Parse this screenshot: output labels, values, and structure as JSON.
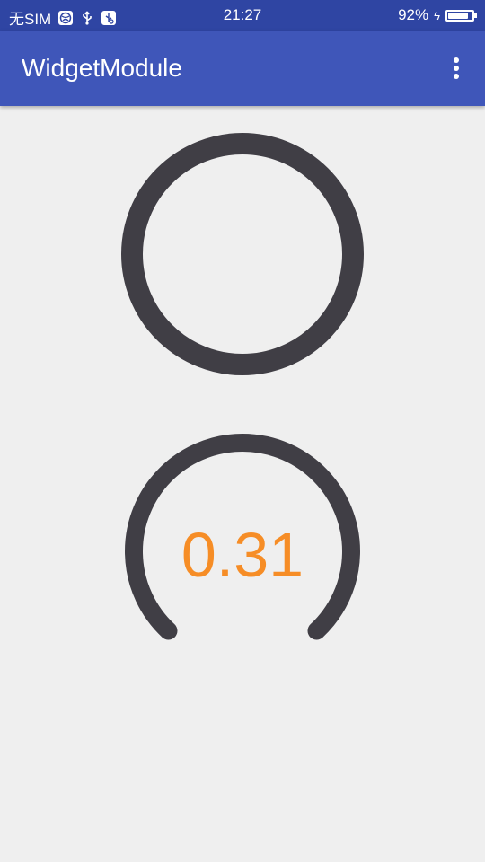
{
  "status_bar": {
    "carrier": "无SIM",
    "time": "21:27",
    "battery_percent": "92%",
    "battery_level": 0.92,
    "icons": [
      "globe-icon",
      "usb-icon",
      "usb-debug-icon",
      "charging-icon",
      "battery-icon"
    ]
  },
  "app_bar": {
    "title": "WidgetModule",
    "menu_icon": "overflow-menu-icon"
  },
  "widgets": {
    "ring": {
      "progress": 1.0,
      "color": "#403e45"
    },
    "gauge": {
      "value_text": "0.31",
      "value_color": "#f68d26",
      "arc_color": "#403e45"
    }
  },
  "colors": {
    "status_bar": "#2f45a3",
    "app_bar": "#3f56b9",
    "background": "#efefef"
  }
}
